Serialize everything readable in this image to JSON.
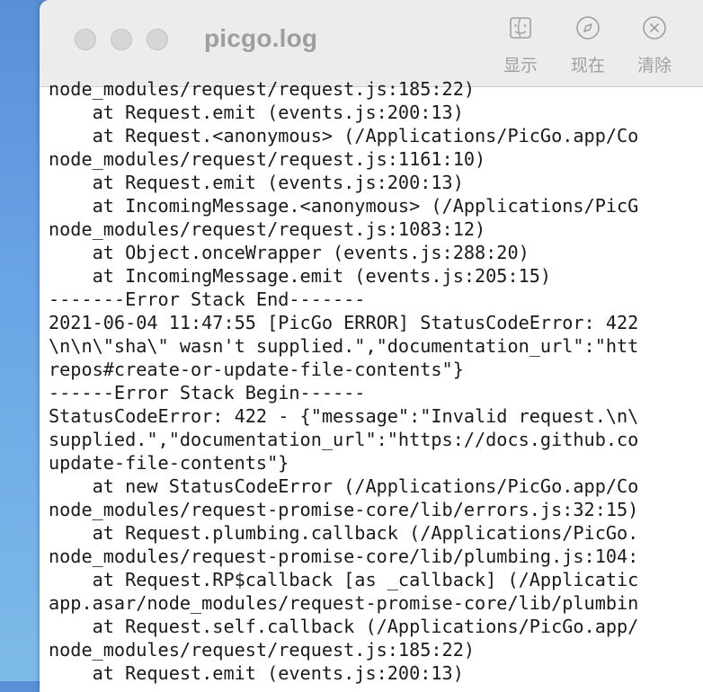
{
  "window": {
    "title": "picgo.log"
  },
  "toolbar": {
    "items": [
      {
        "label": "显示",
        "icon": "finder-icon"
      },
      {
        "label": "现在",
        "icon": "compass-icon"
      },
      {
        "label": "清除",
        "icon": "clear-icon"
      },
      {
        "label": "",
        "icon": ""
      }
    ]
  },
  "log": {
    "lines": [
      "node_modules/request/request.js:185:22)",
      "    at Request.emit (events.js:200:13)",
      "    at Request.<anonymous> (/Applications/PicGo.app/Co",
      "node_modules/request/request.js:1161:10)",
      "    at Request.emit (events.js:200:13)",
      "    at IncomingMessage.<anonymous> (/Applications/PicG",
      "node_modules/request/request.js:1083:12)",
      "    at Object.onceWrapper (events.js:288:20)",
      "    at IncomingMessage.emit (events.js:205:15)",
      "-------Error Stack End-------",
      "2021-06-04 11:47:55 [PicGo ERROR] StatusCodeError: 422",
      "\\n\\n\\\"sha\\\" wasn't supplied.\",\"documentation_url\":\"htt",
      "repos#create-or-update-file-contents\"}",
      "------Error Stack Begin------",
      "StatusCodeError: 422 - {\"message\":\"Invalid request.\\n\\",
      "supplied.\",\"documentation_url\":\"https://docs.github.co",
      "update-file-contents\"}",
      "    at new StatusCodeError (/Applications/PicGo.app/Co",
      "node_modules/request-promise-core/lib/errors.js:32:15)",
      "    at Request.plumbing.callback (/Applications/PicGo.",
      "node_modules/request-promise-core/lib/plumbing.js:104:",
      "    at Request.RP$callback [as _callback] (/Applicatic",
      "app.asar/node_modules/request-promise-core/lib/plumbin",
      "    at Request.self.callback (/Applications/PicGo.app/",
      "node_modules/request/request.js:185:22)",
      "    at Request.emit (events.js:200:13)"
    ]
  }
}
